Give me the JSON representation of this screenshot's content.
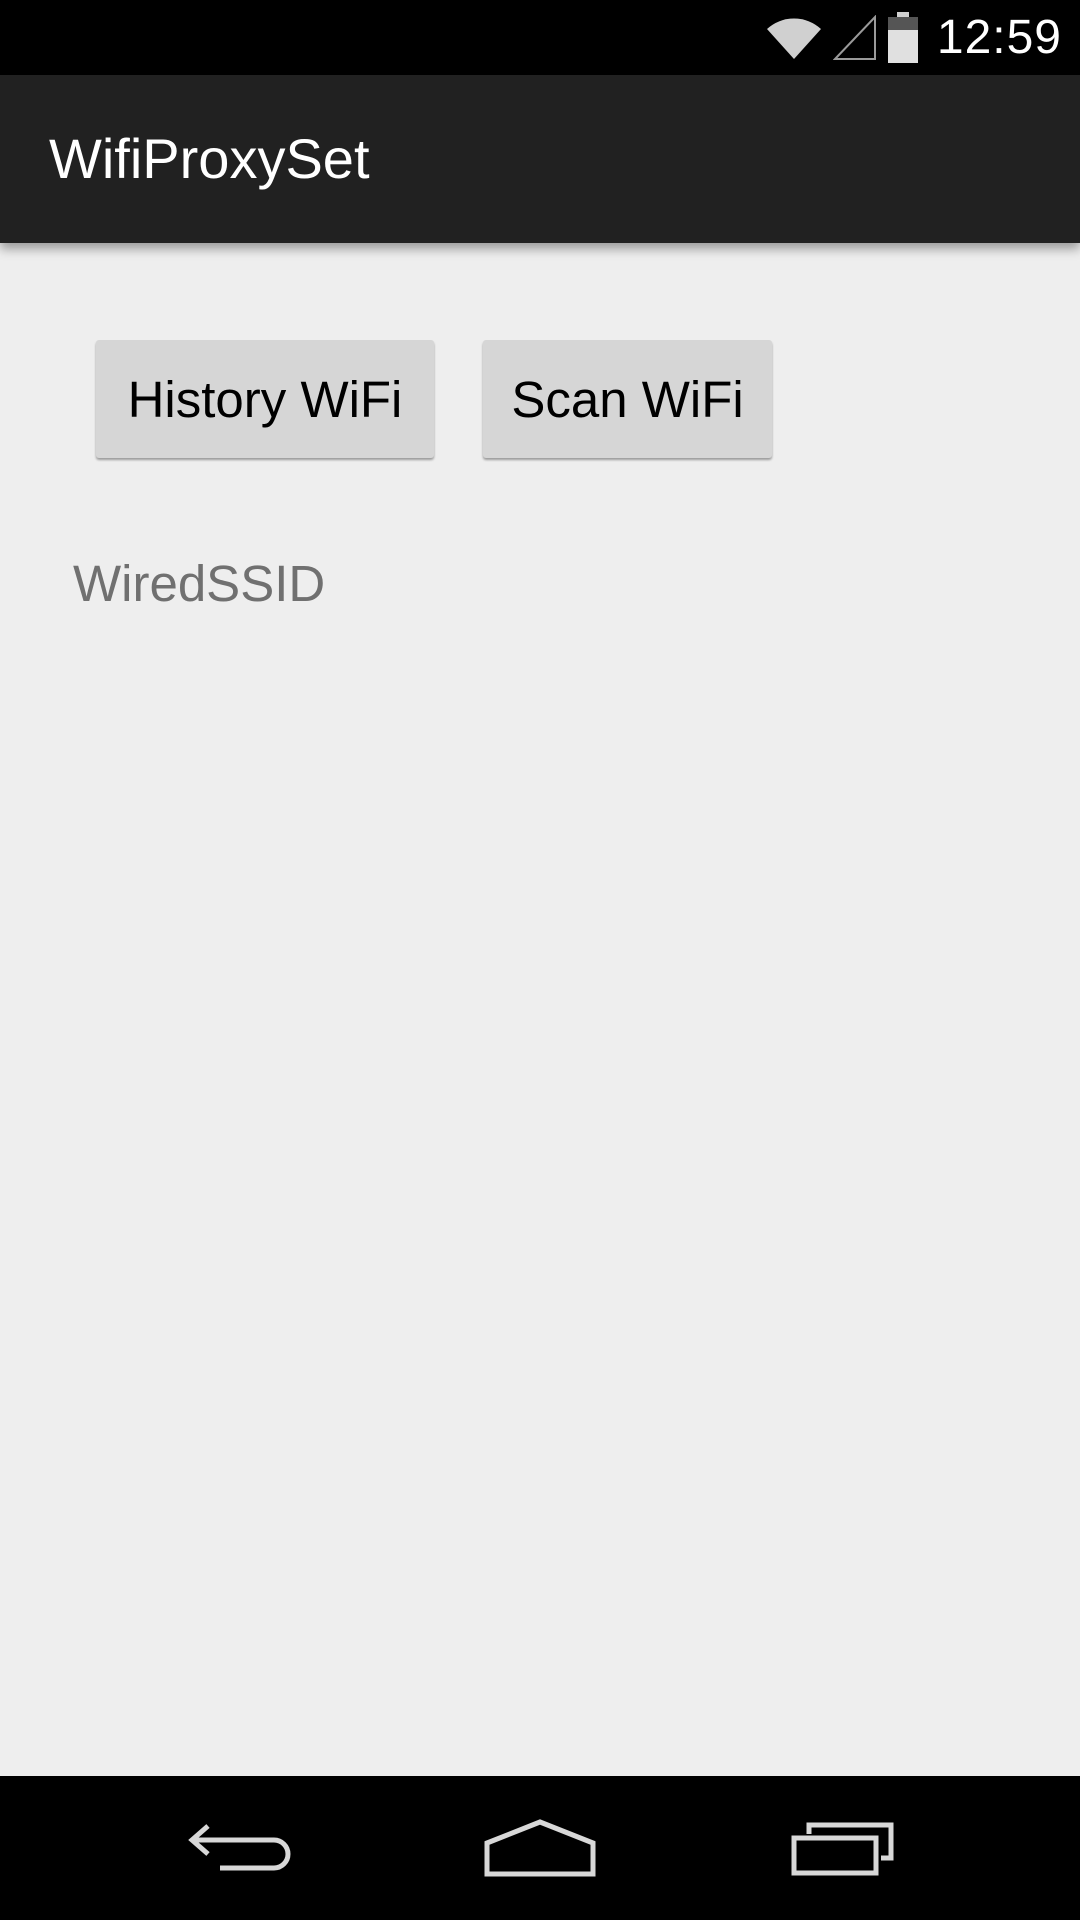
{
  "status_bar": {
    "time": "12:59",
    "icons": [
      "wifi-icon",
      "cell-signal-icon",
      "battery-icon"
    ]
  },
  "app_bar": {
    "title": "WifiProxySet"
  },
  "main": {
    "history_button_label": "History WiFi",
    "scan_button_label": "Scan WiFi",
    "ssid_text": "WiredSSID"
  },
  "nav_bar": {
    "icons": [
      "back-icon",
      "home-icon",
      "recent-apps-icon"
    ]
  },
  "colors": {
    "status_bar_bg": "#000000",
    "app_bar_bg": "#212121",
    "content_bg": "#eeeeee",
    "button_bg": "#d6d6d6",
    "ssid_text": "#707070"
  }
}
